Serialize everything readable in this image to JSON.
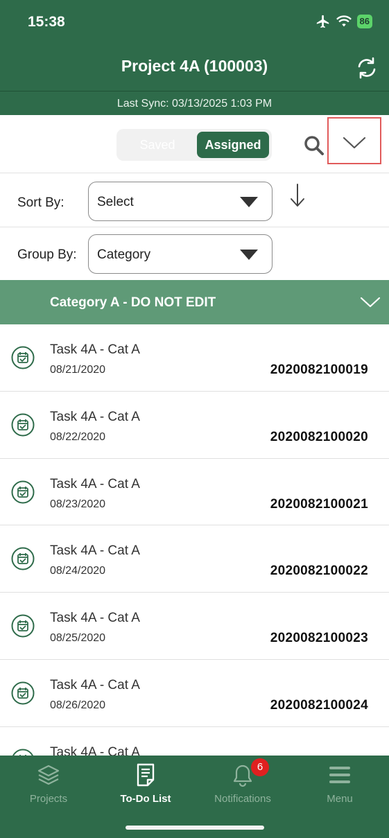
{
  "status_bar": {
    "time": "15:38",
    "battery": "86"
  },
  "header": {
    "title": "Project 4A (100003)",
    "sync_text": "Last Sync: 03/13/2025 1:03 PM"
  },
  "segmented": {
    "saved": "Saved",
    "assigned": "Assigned",
    "selected": "Assigned"
  },
  "sort": {
    "label": "Sort By:",
    "value": "Select"
  },
  "group": {
    "label": "Group By:",
    "value": "Category"
  },
  "category": {
    "title": "Category A - DO NOT EDIT"
  },
  "tasks": [
    {
      "name": "Task 4A - Cat A",
      "date": "08/21/2020",
      "id": "2020082100019"
    },
    {
      "name": "Task 4A - Cat A",
      "date": "08/22/2020",
      "id": "2020082100020"
    },
    {
      "name": "Task 4A - Cat A",
      "date": "08/23/2020",
      "id": "2020082100021"
    },
    {
      "name": "Task 4A - Cat A",
      "date": "08/24/2020",
      "id": "2020082100022"
    },
    {
      "name": "Task 4A - Cat A",
      "date": "08/25/2020",
      "id": "2020082100023"
    },
    {
      "name": "Task 4A - Cat A",
      "date": "08/26/2020",
      "id": "2020082100024"
    },
    {
      "name": "Task 4A - Cat A",
      "date": "",
      "id": ""
    }
  ],
  "tabs": [
    {
      "label": "Projects",
      "icon": "layers-icon"
    },
    {
      "label": "To-Do List",
      "icon": "document-icon"
    },
    {
      "label": "Notifications",
      "icon": "bell-icon",
      "badge": "6"
    },
    {
      "label": "Menu",
      "icon": "menu-icon"
    }
  ],
  "colors": {
    "brand": "#2e6b4a",
    "category_header": "#5f9a77",
    "badge": "#e02020",
    "highlight": "#e15b5b"
  }
}
